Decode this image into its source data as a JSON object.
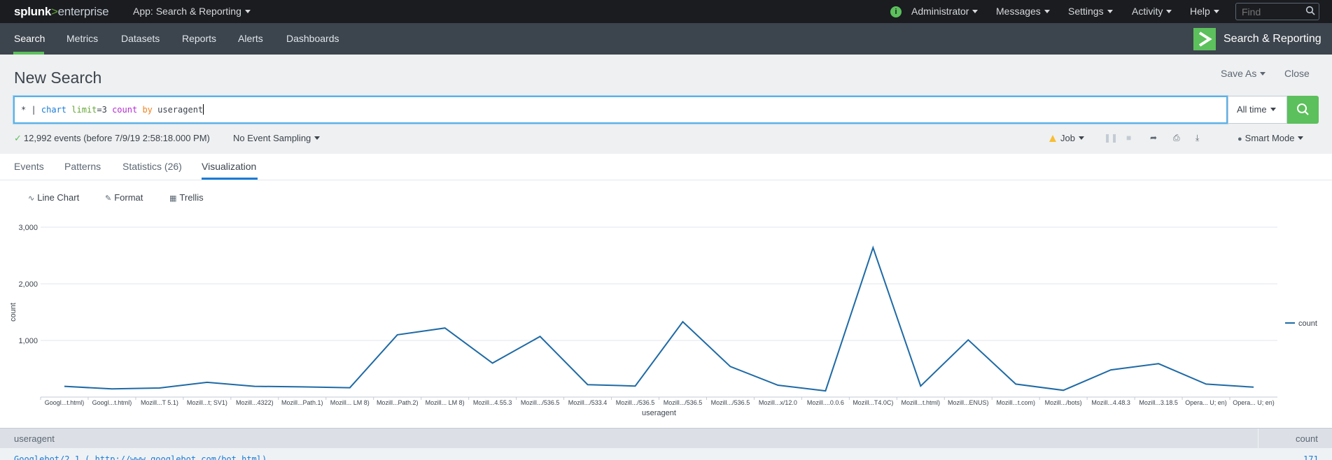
{
  "topbar": {
    "logo_splunk": "splunk",
    "logo_gt": ">",
    "logo_enterprise": "enterprise",
    "app_menu": "App: Search & Reporting",
    "user_menu": "Administrator",
    "messages_menu": "Messages",
    "settings_menu": "Settings",
    "activity_menu": "Activity",
    "help_menu": "Help",
    "find_placeholder": "Find"
  },
  "appbar": {
    "items": [
      {
        "label": "Search"
      },
      {
        "label": "Metrics"
      },
      {
        "label": "Datasets"
      },
      {
        "label": "Reports"
      },
      {
        "label": "Alerts"
      },
      {
        "label": "Dashboards"
      }
    ],
    "app_title": "Search & Reporting"
  },
  "header": {
    "title": "New Search",
    "save_as": "Save As",
    "close": "Close"
  },
  "search": {
    "query_parts": {
      "star": "* | ",
      "cmd": "chart",
      "arg": "limit",
      "eq": "=3 ",
      "fn": "count",
      "kw": "by",
      "field": "useragent"
    },
    "time_range": "All time"
  },
  "status": {
    "events": "12,992 events (before 7/9/19 2:58:18.000 PM)",
    "sampling": "No Event Sampling",
    "job": "Job",
    "mode": "Smart Mode"
  },
  "tabs": [
    {
      "label": "Events"
    },
    {
      "label": "Patterns"
    },
    {
      "label": "Statistics (26)"
    },
    {
      "label": "Visualization"
    }
  ],
  "viz_toolbar": {
    "chart_type": "Line Chart",
    "format": "Format",
    "trellis": "Trellis"
  },
  "colors": {
    "accent_green": "#5cc05c",
    "series_blue": "#1e6aa5",
    "active_tab": "#1a7bd6"
  },
  "chart_data": {
    "type": "line",
    "xlabel": "useragent",
    "ylabel": "count",
    "ylim": [
      0,
      3000
    ],
    "yticks": [
      "1,000",
      "2,000",
      "3,000"
    ],
    "ytick_values": [
      1000,
      2000,
      3000
    ],
    "legend_position": "right",
    "categories": [
      "Googl...t.html)",
      "Googl...t.html)",
      "Mozill...T 5.1)",
      "Mozill...t; SV1)",
      "Mozill...4322)",
      "Mozill...Path.1)",
      "Mozill... LM 8)",
      "Mozill...Path.2)",
      "Mozill... LM 8)",
      "Mozill...4.55.3",
      "Mozill.../536.5",
      "Mozill.../533.4",
      "Mozill.../536.5",
      "Mozill.../536.5",
      "Mozill.../536.5",
      "Mozill...x/12.0",
      "Mozill....0.0.6",
      "Mozill...T4.0C)",
      "Mozill...t.html)",
      "Mozill...ENUS)",
      "Mozill...t.com)",
      "Mozill.../bots)",
      "Mozill...4.48.3",
      "Mozill...3.18.5",
      "Opera... U; en)",
      "Opera... U; en)"
    ],
    "series": [
      {
        "name": "count",
        "values": [
          190,
          145,
          160,
          260,
          190,
          180,
          165,
          1100,
          1220,
          600,
          1070,
          220,
          195,
          1330,
          540,
          210,
          110,
          2640,
          195,
          1010,
          230,
          120,
          480,
          590,
          230,
          175
        ]
      }
    ]
  },
  "table": {
    "col_useragent": "useragent",
    "col_count": "count",
    "first_row_agent": "Googlebot/2.1 ( http://www.googlebot.com/bot.html)",
    "first_row_count": "171"
  }
}
